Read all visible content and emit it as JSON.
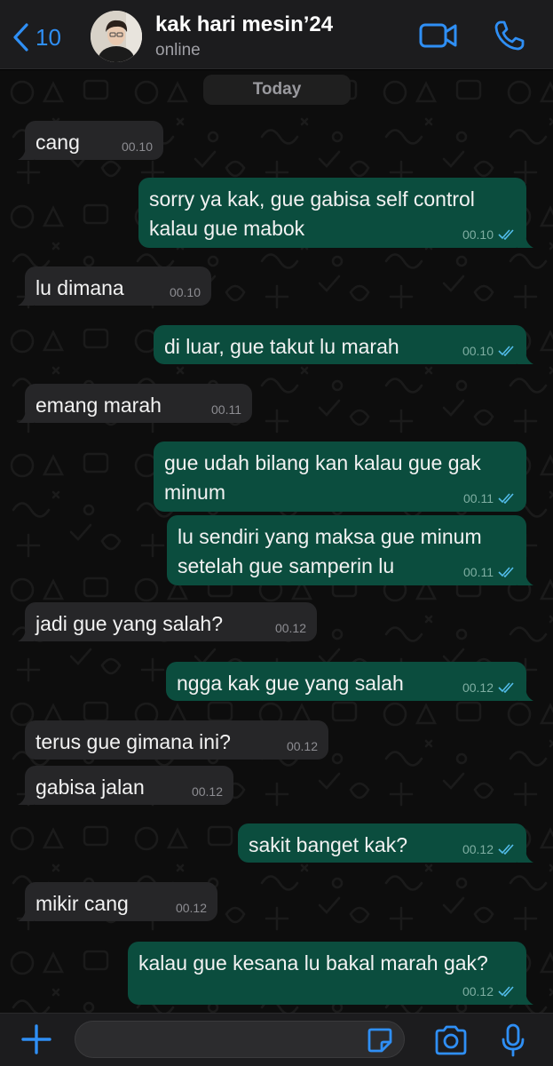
{
  "header": {
    "back_count": "10",
    "contact_name": "kak hari mesin’24",
    "status": "online"
  },
  "chat": {
    "date_label": "Today",
    "messages": [
      {
        "dir": "in",
        "lines": [
          "cang"
        ],
        "time": "00.10"
      },
      {
        "dir": "out",
        "lines": [
          "sorry ya kak, gue gabisa self control",
          "kalau gue mabok"
        ],
        "time": "00.10"
      },
      {
        "dir": "in",
        "lines": [
          "lu dimana"
        ],
        "time": "00.10"
      },
      {
        "dir": "out",
        "lines": [
          "di luar, gue takut lu marah"
        ],
        "time": "00.10"
      },
      {
        "dir": "in",
        "lines": [
          "emang marah"
        ],
        "time": "00.11"
      },
      {
        "dir": "out",
        "lines": [
          "gue udah bilang kan kalau gue gak",
          "minum"
        ],
        "time": "00.11"
      },
      {
        "dir": "out",
        "lines": [
          "lu sendiri yang maksa gue minum",
          "setelah gue samperin lu"
        ],
        "time": "00.11"
      },
      {
        "dir": "in",
        "lines": [
          "jadi gue yang salah?"
        ],
        "time": "00.12"
      },
      {
        "dir": "out",
        "lines": [
          "ngga kak gue yang salah"
        ],
        "time": "00.12"
      },
      {
        "dir": "in",
        "lines": [
          "terus gue gimana ini?"
        ],
        "time": "00.12"
      },
      {
        "dir": "in",
        "lines": [
          "gabisa jalan"
        ],
        "time": "00.12"
      },
      {
        "dir": "out",
        "lines": [
          "sakit banget kak?"
        ],
        "time": "00.12"
      },
      {
        "dir": "in",
        "lines": [
          "mikir cang"
        ],
        "time": "00.12"
      },
      {
        "dir": "out",
        "lines": [
          "kalau gue kesana lu bakal marah gak?"
        ],
        "time": "00.12"
      }
    ]
  },
  "composer": {
    "value": ""
  },
  "colors": {
    "accent": "#2f8ff5",
    "incoming_bubble": "#262628",
    "outgoing_bubble": "#0b4d3e",
    "read_ticks": "#53bdeb"
  },
  "icons": [
    "chevron-left-icon",
    "video-camera-icon",
    "phone-icon",
    "plus-icon",
    "sticker-icon",
    "camera-icon",
    "microphone-icon",
    "double-check-icon"
  ]
}
